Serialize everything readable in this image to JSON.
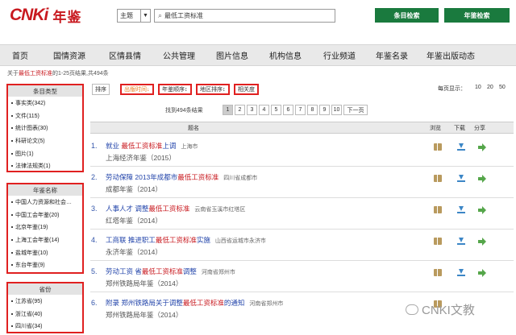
{
  "brand": {
    "logo_text": "CNKi",
    "product": "年鉴"
  },
  "search": {
    "field": "主题",
    "query": "最低工资标准",
    "btn_entry": "条目检索",
    "btn_yearbook": "年鉴检索"
  },
  "nav": [
    "首页",
    "国情资源",
    "区情县情",
    "公共管理",
    "图片信息",
    "机构信息",
    "行业频道",
    "年鉴名录",
    "年鉴出版动态"
  ],
  "crumb": {
    "prefix": "关于",
    "keyword": "最低工资标准",
    "suffix": "的1-25页结果,共494条"
  },
  "facets": [
    {
      "head": "条目类型",
      "items": [
        "事实类(342)",
        "文件(115)",
        "统计图表(30)",
        "科研论文(5)",
        "图片(1)",
        "法律法规类(1)"
      ]
    },
    {
      "head": "年鉴名称",
      "items": [
        "中国人力资源和社会…",
        "中国工会年鉴(20)",
        "北京年鉴(19)",
        "上海工会年鉴(14)",
        "盐城年鉴(10)",
        "东台年鉴(9)"
      ]
    },
    {
      "head": "省份",
      "items": [
        "江苏省(95)",
        "浙江省(40)",
        "四川省(34)"
      ]
    }
  ],
  "sort": {
    "label": "排序",
    "pub_time": "出版时间",
    "year_order": "年鉴顺序",
    "region_order": "地区排序",
    "relevance": "相关度",
    "per_page_label": "每页显示：",
    "per_page": [
      "10",
      "20",
      "50"
    ]
  },
  "pager": {
    "found": "找到494条结果",
    "pages": [
      "1",
      "2",
      "3",
      "4",
      "5",
      "6",
      "7",
      "8",
      "9",
      "10"
    ],
    "next": "下一页"
  },
  "table_head": {
    "title": "题名",
    "browse": "浏览",
    "download": "下载",
    "share": "分享"
  },
  "results": [
    {
      "num": "1.",
      "pre": "就业 ",
      "hl": "最低工资标准",
      "post": "上调",
      "loc": "上海市",
      "book": "上海经济年鉴（2015）"
    },
    {
      "num": "2.",
      "pre": "劳动保障 2013年成都市",
      "hl": "最低工资标准",
      "post": "",
      "loc": "四川省成都市",
      "book": "成都年鉴（2014）"
    },
    {
      "num": "3.",
      "pre": "人事人才 调整",
      "hl": "最低工资标准",
      "post": "",
      "loc": "云南省玉溪市红塔区",
      "book": "红塔年鉴（2014）"
    },
    {
      "num": "4.",
      "pre": "工商联 推进职工",
      "hl": "最低工资标准",
      "post": "实施",
      "loc": "山西省运城市永济市",
      "book": "永济年鉴（2014）"
    },
    {
      "num": "5.",
      "pre": "劳动工资 省",
      "hl": "最低工资标准",
      "post": "调整",
      "loc": "河南省郑州市",
      "book": "郑州铁路局年鉴（2014）"
    },
    {
      "num": "6.",
      "pre": "附录 郑州铁路局关于调整",
      "hl": "最低工资标准",
      "post": "的通知",
      "loc": "河南省郑州市",
      "book": "郑州铁路局年鉴（2014）"
    }
  ],
  "watermark": "CNKI文教"
}
